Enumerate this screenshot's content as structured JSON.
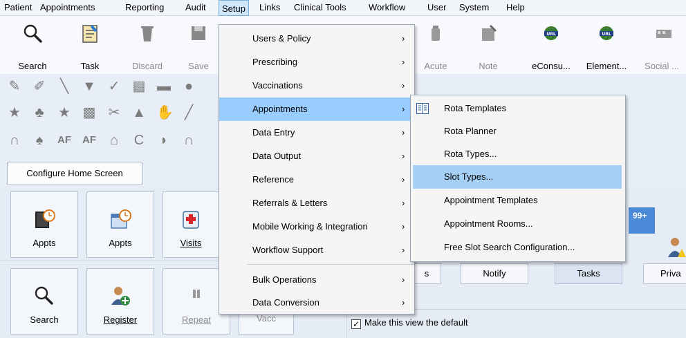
{
  "menubar": {
    "items": [
      "Patient",
      "Appointments",
      "Reporting",
      "Audit",
      "Setup",
      "Links",
      "Clinical Tools",
      "Workflow",
      "User",
      "System",
      "Help"
    ],
    "open_item": "Setup"
  },
  "toolbar": {
    "buttons": [
      {
        "label": "Search",
        "icon": "search-icon",
        "enabled": true
      },
      {
        "label": "Task",
        "icon": "task-icon",
        "enabled": true
      },
      {
        "label": "Discard",
        "icon": "discard-icon",
        "enabled": false
      },
      {
        "label": "Save",
        "icon": "save-icon",
        "enabled": false
      },
      {
        "label": "Acute",
        "icon": "acute-icon",
        "enabled": false
      },
      {
        "label": "Note",
        "icon": "note-icon",
        "enabled": false
      },
      {
        "label": "eConsu...",
        "icon": "url-globe-icon",
        "enabled": true
      },
      {
        "label": "Element...",
        "icon": "url-globe-icon",
        "enabled": true
      },
      {
        "label": "Social ...",
        "icon": "social-icon",
        "enabled": false
      }
    ]
  },
  "home": {
    "configure_label": "Configure Home Screen",
    "tiles_row1": [
      {
        "label": "Appts",
        "icon": "appointments-book-icon"
      },
      {
        "label": "Appts",
        "icon": "appointments-calendar-icon"
      },
      {
        "label": "Visits",
        "icon": "visits-medical-bag-icon"
      }
    ],
    "tiles_row2": [
      {
        "label": "Search",
        "icon": "search-icon",
        "enabled": true
      },
      {
        "label": "Register",
        "icon": "register-patient-icon",
        "enabled": true
      },
      {
        "label": "Repeat",
        "icon": "repeat-icon",
        "enabled": false
      },
      {
        "label": "Vacc",
        "icon": "vaccination-icon",
        "enabled": false
      }
    ],
    "tabs": [
      {
        "label": "s",
        "selected": false
      },
      {
        "label": "Notify",
        "selected": false
      },
      {
        "label": "Tasks",
        "selected": true
      },
      {
        "label": "Priva",
        "selected": false
      }
    ],
    "badge": "99+",
    "default_view_checkbox": {
      "label": "Make this view the default",
      "checked": true
    }
  },
  "setup_menu": {
    "items": [
      {
        "label": "Users & Policy",
        "has_submenu": true
      },
      {
        "label": "Prescribing",
        "has_submenu": true
      },
      {
        "label": "Vaccinations",
        "has_submenu": true
      },
      {
        "label": "Appointments",
        "has_submenu": true,
        "highlighted": true
      },
      {
        "label": "Data Entry",
        "has_submenu": true
      },
      {
        "label": "Data Output",
        "has_submenu": true
      },
      {
        "label": "Reference",
        "has_submenu": true
      },
      {
        "label": "Referrals & Letters",
        "has_submenu": true
      },
      {
        "label": "Mobile Working & Integration",
        "has_submenu": true
      },
      {
        "label": "Workflow Support",
        "has_submenu": true
      },
      {
        "label": "Bulk Operations",
        "has_submenu": true
      },
      {
        "label": "Data Conversion",
        "has_submenu": true
      }
    ]
  },
  "appointments_submenu": {
    "items": [
      {
        "label": "Rota Templates",
        "icon": "book-icon"
      },
      {
        "label": "Rota Planner"
      },
      {
        "label": "Rota Types..."
      },
      {
        "label": "Slot Types...",
        "highlighted": true
      },
      {
        "label": "Appointment Templates"
      },
      {
        "label": "Appointment Rooms..."
      },
      {
        "label": "Free Slot Search Configuration..."
      }
    ]
  },
  "colors": {
    "menu_highlight": "#99ccff",
    "badge": "#4b8ad6",
    "background": "#e8eef7"
  }
}
